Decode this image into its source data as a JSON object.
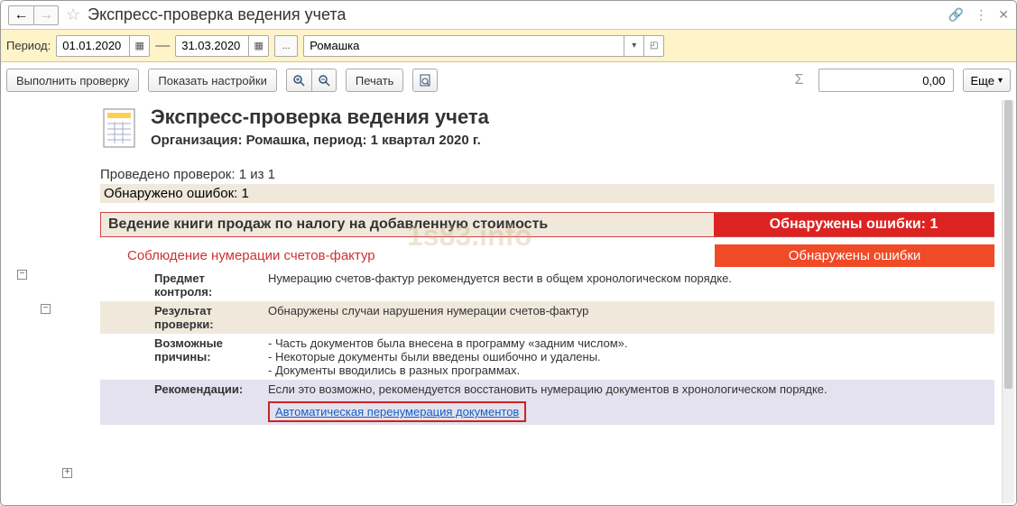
{
  "titlebar": {
    "title": "Экспресс-проверка ведения учета"
  },
  "period": {
    "label": "Период:",
    "from": "01.01.2020",
    "to": "31.03.2020",
    "org": "Ромашка"
  },
  "toolbar": {
    "run": "Выполнить проверку",
    "settings": "Показать настройки",
    "print": "Печать",
    "sum": "0,00",
    "more": "Еще"
  },
  "report": {
    "title": "Экспресс-проверка ведения учета",
    "subtitle": "Организация: Ромашка, период: 1 квартал 2020 г.",
    "checks": "Проведено проверок: 1 из 1",
    "errors": "Обнаружено ошибок: 1",
    "section1": {
      "title": "Ведение книги продаж по налогу на добавленную стоимость",
      "status": "Обнаружены ошибки: 1"
    },
    "section2": {
      "title": "Соблюдение нумерации счетов-фактур",
      "status": "Обнаружены ошибки"
    },
    "rows": {
      "r1l": "Предмет контроля:",
      "r1v": "Нумерацию счетов-фактур рекомендуется вести в общем хронологическом порядке.",
      "r2l": "Результат проверки:",
      "r2v": "Обнаружены случаи нарушения нумерации счетов-фактур",
      "r3l": "Возможные причины:",
      "r3v1": "- Часть документов была внесена в программу «задним числом».",
      "r3v2": "- Некоторые документы были введены ошибочно и удалены.",
      "r3v3": "- Документы вводились в разных программах.",
      "r4l": "Рекомендации:",
      "r4v": "Если это возможно, рекомендуется восстановить нумерацию документов в хронологическом порядке.",
      "link": "Автоматическая перенумерация документов"
    }
  },
  "watermark": "1s83.info"
}
